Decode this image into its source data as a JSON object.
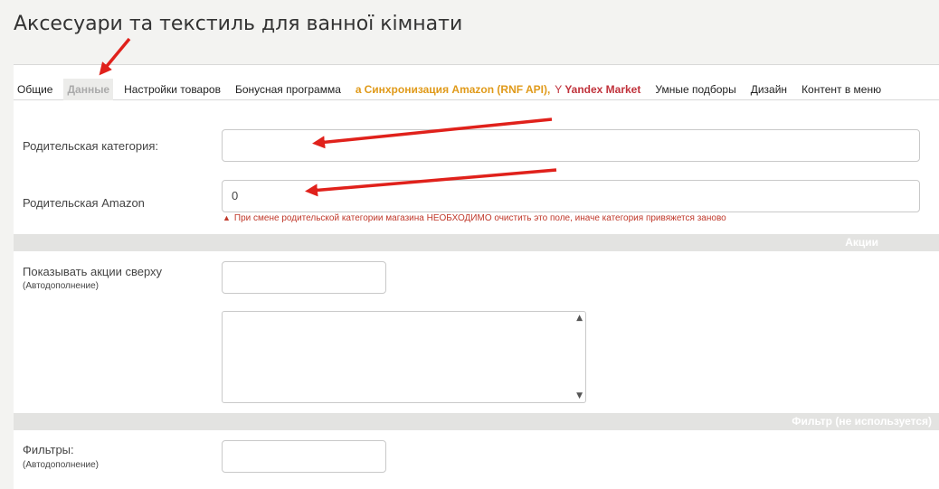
{
  "page": {
    "title": "Аксесуари та текстиль для ванної кімнати"
  },
  "tabs": [
    {
      "label": "Общие"
    },
    {
      "label": "Данные"
    },
    {
      "label": "Настройки товаров"
    },
    {
      "label": "Бонусная программа"
    },
    {
      "label": "Синхронизация Amazon (RNF API),",
      "extra": "Yandex Market"
    },
    {
      "label": "Умные подборы"
    },
    {
      "label": "Дизайн"
    },
    {
      "label": "Контент в меню"
    }
  ],
  "fields": {
    "parent_category": {
      "label": "Родительская категория:",
      "value": ""
    },
    "parent_amazon": {
      "label": "Родительская Amazon",
      "value": "0",
      "warning": "При смене родительской категории магазина НЕОБХОДИМО очистить это поле, иначе категория привяжется заново"
    },
    "promos_top": {
      "label": "Показывать акции сверху",
      "sublabel": "(Автодополнение)",
      "value": ""
    },
    "filters": {
      "label": "Фильтры:",
      "sublabel": "(Автодополнение)",
      "value": ""
    }
  },
  "sections": {
    "promos": "Акции",
    "filter": "Фильтр (не используется)"
  },
  "colors": {
    "annotation_arrow": "#e0211b",
    "amazon": "#e09a1a",
    "yandex": "#c0323b",
    "warning": "#c0392b"
  }
}
